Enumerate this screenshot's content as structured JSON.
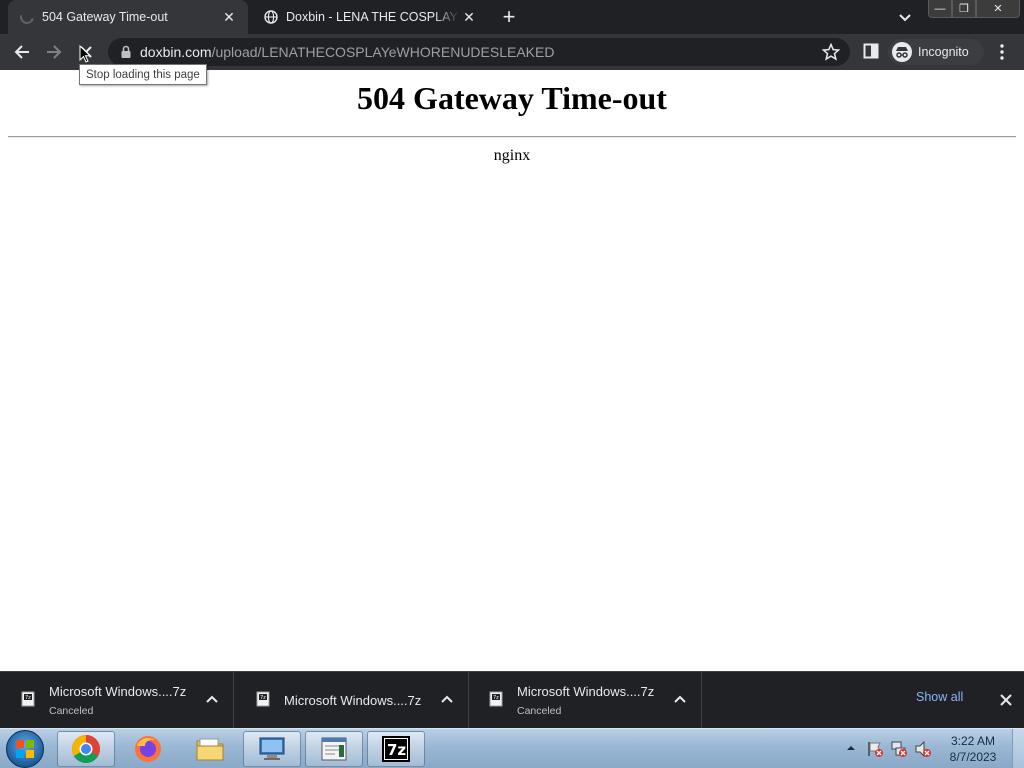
{
  "browser": {
    "tabs": [
      {
        "title": "504 Gateway Time-out",
        "active": true,
        "loading": true
      },
      {
        "title": "Doxbin - LENA THE COSPLAY eWHORE",
        "active": false,
        "favicon": "globe-icon"
      }
    ],
    "url": {
      "host": "doxbin.com",
      "path": "/upload/LENATHECOSPLAYeWHORENUDESLEAKED"
    },
    "profile_label": "Incognito",
    "tooltip": "Stop loading this page"
  },
  "page": {
    "heading": "504 Gateway Time-out",
    "server": "nginx"
  },
  "downloads": {
    "items": [
      {
        "name": "Microsoft Windows....7z",
        "status": "Canceled"
      },
      {
        "name": "Microsoft Windows....7z",
        "status": ""
      },
      {
        "name": "Microsoft Windows....7z",
        "status": "Canceled"
      }
    ],
    "show_all": "Show all"
  },
  "taskbar": {
    "apps": [
      "chrome-icon",
      "firefox-icon",
      "file-explorer-icon",
      "remote-desktop-icon",
      "notepad-icon",
      "7zip-icon"
    ],
    "time": "3:22 AM",
    "date": "8/7/2023"
  },
  "colors": {
    "tab_strip": "#202124",
    "toolbar": "#35363a",
    "link_blue": "#8ab4f8"
  }
}
